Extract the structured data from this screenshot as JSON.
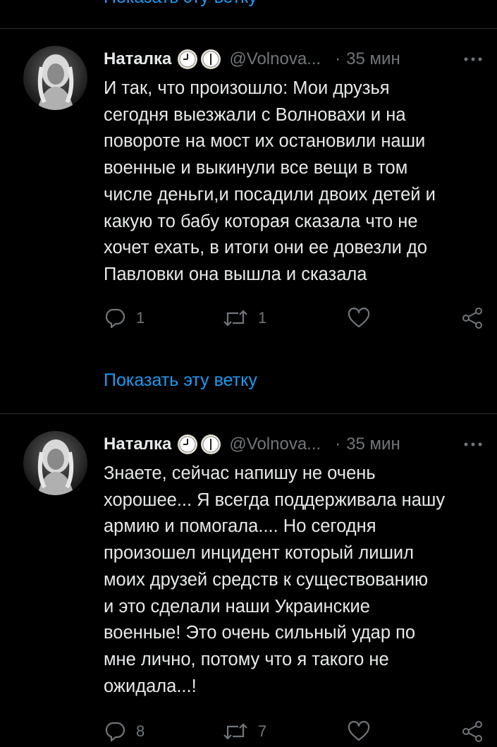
{
  "top_link": "Показать эту ветку",
  "tweets": [
    {
      "name": "Наталка",
      "handle": "@Volnova...",
      "separator": "·",
      "time": "35 мин",
      "text": "И так, что произошло: Мои друзья\nсегодня выезжали с Волновахи и на\nповороте на мост их остановили наши\nвоенные и выкинули все вещи в том\nчисле деньги,и посадили двоих детей и\nкакую то бабу которая сказала что не\nхочет ехать, в итоги они ее довезли до\nПавловки она вышла и сказала",
      "replies": "1",
      "retweets": "1",
      "likes": "",
      "show_thread": "Показать эту ветку"
    },
    {
      "name": "Наталка",
      "handle": "@Volnova...",
      "separator": "·",
      "time": "35 мин",
      "text": "Знаете, сейчас напишу не очень\nхорошее... Я всегда поддерживала нашу\nармию и помогала.... Но сегодня\nпроизошел инцидент который лишил\nмоих друзей средств к существованию\nи это сделали наши Украинские\nвоенные! Это очень сильный удар по\nмне лично, потому что я такого не\nожидала...!",
      "replies": "8",
      "retweets": "7",
      "likes": ""
    }
  ],
  "icons": {
    "badge": "clock-icon",
    "more": "more-dots-icon",
    "reply": "reply-icon",
    "retweet": "retweet-icon",
    "like": "heart-icon",
    "share": "share-icon"
  },
  "colors": {
    "background": "#000000",
    "text": "#e7e9ea",
    "secondary": "#71767b",
    "link": "#1d9bf0",
    "divider": "#2f3336"
  }
}
